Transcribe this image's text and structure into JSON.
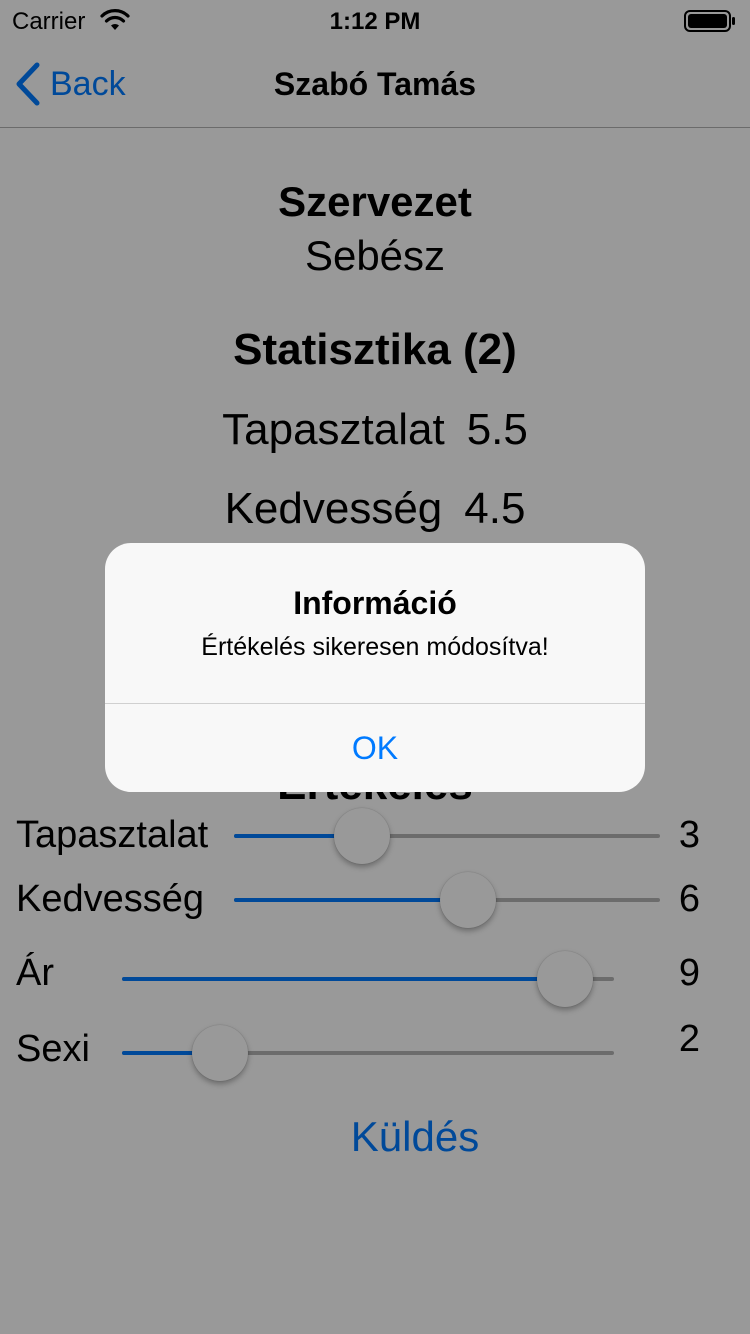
{
  "status_bar": {
    "carrier": "Carrier",
    "time": "1:12 PM"
  },
  "nav": {
    "back_label": "Back",
    "title": "Szabó Tamás"
  },
  "organization": {
    "heading": "Szervezet",
    "value": "Sebész"
  },
  "statistics": {
    "heading": "Statisztika (2)",
    "items": [
      {
        "label": "Tapasztalat",
        "value": "5.5"
      },
      {
        "label": "Kedvesség",
        "value": "4.5"
      }
    ]
  },
  "rating": {
    "heading": "Értékelés",
    "sliders": [
      {
        "label": "Tapasztalat",
        "value": "3",
        "fraction": 0.3
      },
      {
        "label": "Kedvesség",
        "value": "6",
        "fraction": 0.55
      },
      {
        "label": "Ár",
        "value": "9",
        "fraction": 0.9
      },
      {
        "label": "Sexi",
        "value": "2",
        "fraction": 0.2
      }
    ]
  },
  "submit_label": "Küldés",
  "alert": {
    "title": "Információ",
    "message": "Értékelés sikeresen módosítva!",
    "ok_label": "OK"
  },
  "colors": {
    "accent": "#007aff",
    "dim": "rgba(0,0,0,0.4)"
  }
}
